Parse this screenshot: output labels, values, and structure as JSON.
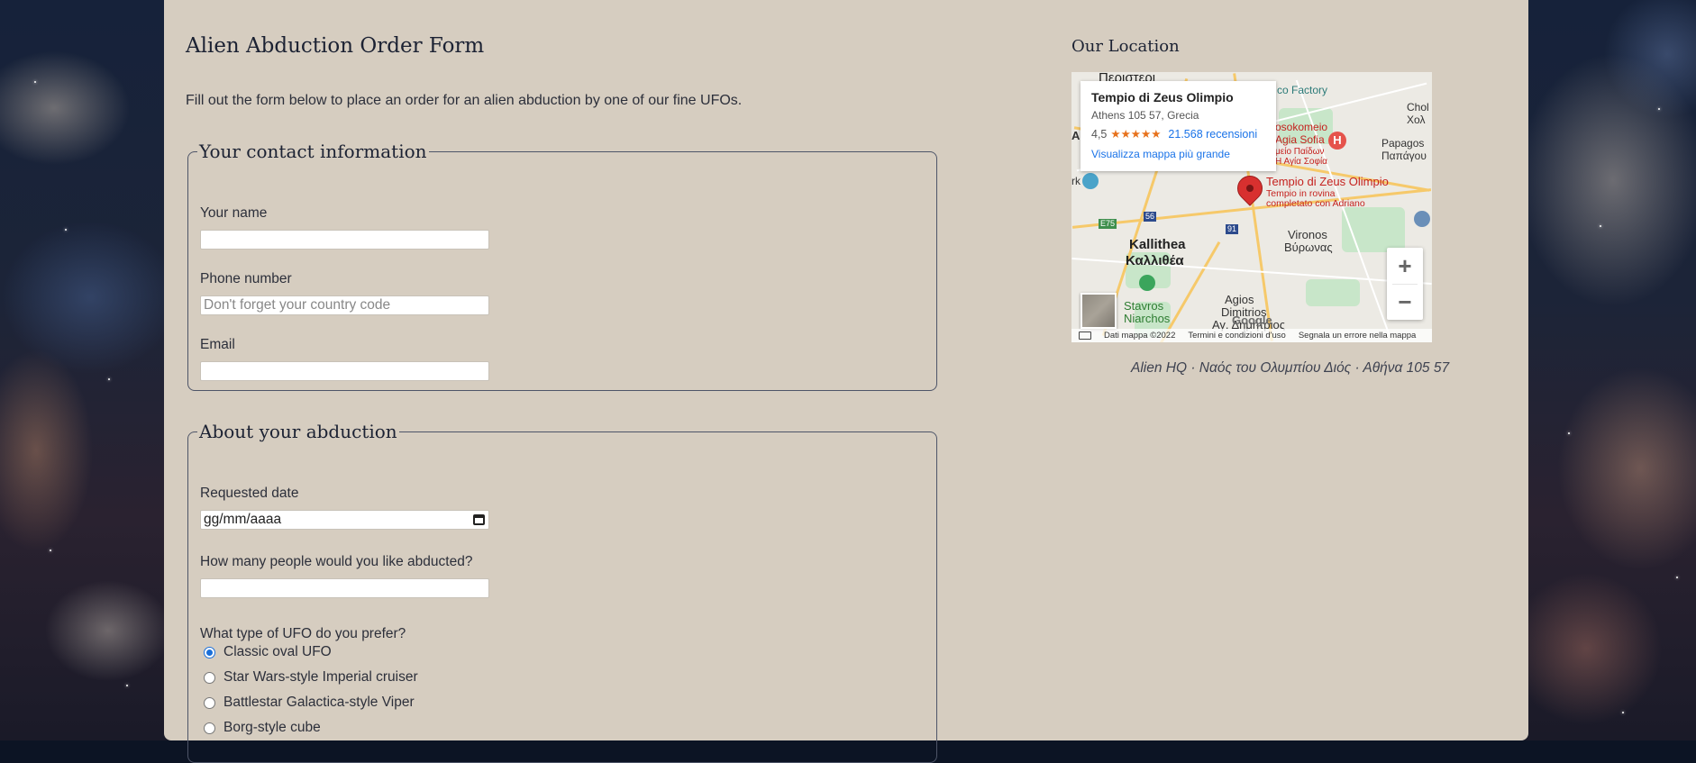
{
  "page": {
    "title": "Alien Abduction Order Form",
    "intro": "Fill out the form below to place an order for an alien abduction by one of our fine UFOs."
  },
  "contact": {
    "legend": "Your contact information",
    "name_label": "Your name",
    "name_value": "",
    "phone_label": "Phone number",
    "phone_placeholder": "Don't forget your country code",
    "email_label": "Email",
    "email_value": ""
  },
  "abduction": {
    "legend": "About your abduction",
    "date_label": "Requested date",
    "date_value": "gg/mm/aaaa",
    "people_label": "How many people would you like abducted?",
    "people_value": "",
    "ufo_label": "What type of UFO do you prefer?",
    "ufo_options": [
      {
        "label": "Classic oval UFO",
        "checked": true
      },
      {
        "label": "Star Wars-style Imperial cruiser",
        "checked": false
      },
      {
        "label": "Battlestar Galactica-style Viper",
        "checked": false
      },
      {
        "label": "Borg-style cube",
        "checked": false
      }
    ]
  },
  "location": {
    "title": "Our Location",
    "address_caption": "Alien HQ · Ναός του Ολυμπίου Διός · Αθήνα 105 57",
    "map": {
      "card_title": "Tempio di Zeus Olimpio",
      "card_address": "Athens 105 57, Grecia",
      "rating": "4,5",
      "stars": "★★★★★",
      "reviews": "21.568 recensioni",
      "bigger_map_link": "Visualizza mappa più grande",
      "labels": {
        "peristeri": "Περιστερι",
        "factory": "co Factory",
        "chol": "Chol",
        "cholo": "Χολ",
        "papagos": "Papagos",
        "papagou": "Παπάγου",
        "sofia1": "osokomeio",
        "sofia2": "Agia Sofia",
        "sofia3": "μείο Παίδων",
        "sofia4": "Η Αγία Σοφία",
        "pin_name": "Tempio di Zeus Olimpio",
        "pin_sub1": "Tempio in rovina",
        "pin_sub2": "completato con Adriano",
        "kallithea": "Kallithea",
        "kallithea_gr": "Καλλιθέα",
        "vironos": "Vironos",
        "vironos_gr": "Βύρωνας",
        "agios": "Agios",
        "dimitrios": "Dimitrios",
        "dimitrios_gr": "Αγ. Δημήτριος",
        "stavros": "Stavros",
        "niarchos": "Niarchos",
        "e75": "E75",
        "r56": "56",
        "r91": "91",
        "letter_a": "A",
        "letter_rk": "rk",
        "google": "Google"
      },
      "zoom_in": "+",
      "zoom_out": "−",
      "attr_data": "Dati mappa ©2022",
      "attr_terms": "Termini e condizioni d'uso",
      "attr_report": "Segnala un errore nella mappa",
      "hospital_glyph": "H"
    }
  }
}
